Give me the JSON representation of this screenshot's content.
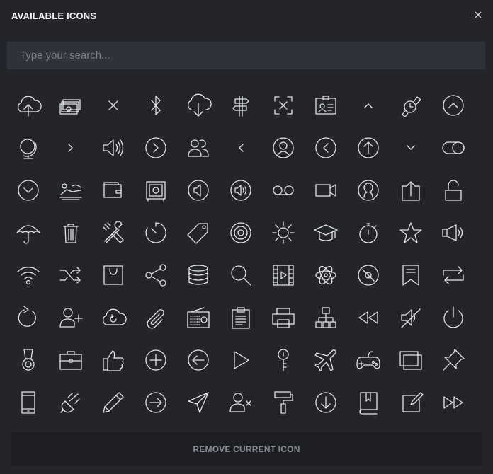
{
  "dialog": {
    "title": "AVAILABLE ICONS",
    "close_icon": "close-icon"
  },
  "search": {
    "placeholder": "Type your search...",
    "value": ""
  },
  "icons": [
    "cloud-upload-icon",
    "money-stack-icon",
    "close-icon",
    "bluetooth-icon",
    "cloud-download-icon",
    "signpost-icon",
    "focus-frame-icon",
    "id-card-icon",
    "chevron-up-icon",
    "smartwatch-icon",
    "arrow-up-circle-icon",
    "globe-icon",
    "chevron-right-icon",
    "volume-icon",
    "arrow-right-circle-icon",
    "users-icon",
    "chevron-left-icon",
    "user-circle-icon",
    "arrow-left-circle-icon",
    "arrow-up-circle-outline-icon",
    "chevron-down-icon",
    "toggle-icon",
    "chevron-down-circle-icon",
    "sunbathing-icon",
    "wallet-icon",
    "safe-icon",
    "volume-low-circle-icon",
    "volume-high-circle-icon",
    "voicemail-icon",
    "video-camera-icon",
    "user-avatar-icon",
    "upload-box-icon",
    "unlock-icon",
    "umbrella-icon",
    "trash-icon",
    "tools-icon",
    "timer-icon",
    "tag-icon",
    "target-icon",
    "brightness-icon",
    "graduation-cap-icon",
    "stopwatch-icon",
    "star-icon",
    "megaphone-icon",
    "wifi-icon",
    "shuffle-icon",
    "shopping-bag-icon",
    "share-icon",
    "database-icon",
    "search-icon",
    "film-icon",
    "atom-icon",
    "disc-icon",
    "bookmark-icon",
    "repeat-icon",
    "refresh-icon",
    "user-add-icon",
    "cloud-sync-icon",
    "paperclip-icon",
    "radio-icon",
    "clipboard-icon",
    "printer-icon",
    "sitemap-icon",
    "rewind-icon",
    "mute-icon",
    "power-icon",
    "medal-icon",
    "briefcase-icon",
    "thumbs-up-icon",
    "add-circle-icon",
    "arrow-left-circle-2-icon",
    "play-icon",
    "key-icon",
    "airplane-icon",
    "gamepad-icon",
    "windows-icon",
    "pushpin-icon",
    "mobile-phone-icon",
    "plug-icon",
    "pencil-icon",
    "arrow-right-circle-2-icon",
    "send-icon",
    "user-remove-icon",
    "paint-roller-icon",
    "arrow-down-circle-icon",
    "book-icon",
    "edit-icon",
    "fast-forward-icon"
  ],
  "footer": {
    "remove_label": "REMOVE CURRENT ICON"
  }
}
